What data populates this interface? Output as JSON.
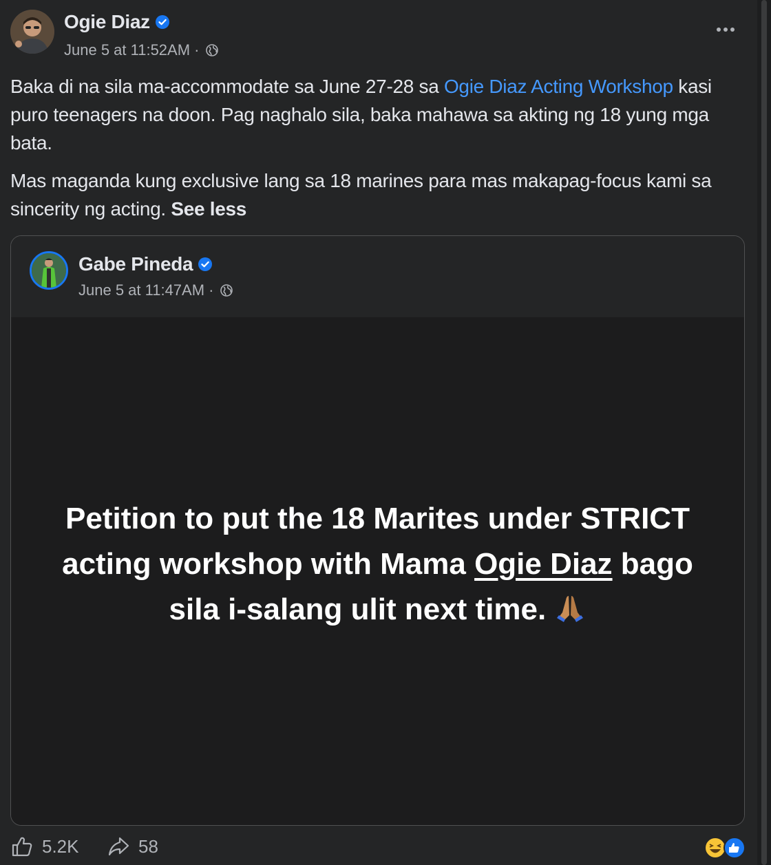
{
  "post": {
    "author": "Ogie Diaz",
    "timestamp": "June 5 at 11:52AM ·",
    "text": {
      "line1_prefix": "Baka di na sila ma-accommodate sa June 27-28 sa ",
      "link": "Ogie Diaz Acting Workshop",
      "line1_suffix": " kasi puro teenagers na doon. Pag naghalo sila, baka mahawa sa akting ng 18 yung mga bata.",
      "paragraph2": "Mas maganda kung exclusive lang sa 18 marines para mas makapag-focus kami sa sincerity ng acting. ",
      "see_less": "See less"
    }
  },
  "shared_post": {
    "author": "Gabe Pineda",
    "timestamp": "June 5 at 11:47AM ·",
    "text_before": "Petition to put the 18 Marites under STRICT acting workshop with Mama ",
    "mention": "Ogie Diaz",
    "text_after": " bago sila i-salang ulit next time. "
  },
  "footer": {
    "likes": "5.2K",
    "shares": "58"
  },
  "icons": {
    "verified": "verified-badge-icon",
    "globe": "globe-icon",
    "more": "more-options-icon",
    "like": "thumbs-up-icon",
    "share": "share-arrow-icon",
    "pray": "folded-hands-emoji",
    "reactions": [
      "laughing-emoji",
      "like-reaction"
    ]
  },
  "colors": {
    "background": "#242526",
    "text": "#e4e6eb",
    "secondary": "#b0b3b8",
    "link": "#4599ff",
    "verified": "#1877f2"
  }
}
